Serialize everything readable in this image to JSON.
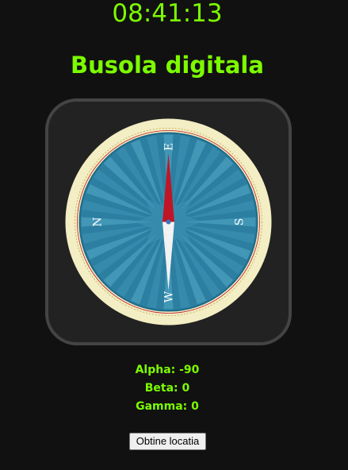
{
  "clock": {
    "time": "08:41:13"
  },
  "header": {
    "title": "Busola digitala"
  },
  "compass": {
    "dial_labels": {
      "east": "E",
      "south": "S",
      "west": "W",
      "north": "N"
    },
    "heading_deg": -90,
    "colors": {
      "dial_blue": "#2c7fa1",
      "outer_ring": "#f3eec3",
      "needle_red": "#c01526",
      "needle_white": "#f2f2f2"
    }
  },
  "readings": {
    "alpha": "Alpha: -90",
    "beta": "Beta: 0",
    "gamma": "Gamma: 0"
  },
  "actions": {
    "locate_label": "Obtine locatia"
  },
  "theme": {
    "accent": "#7CFC00",
    "background": "#111111"
  }
}
